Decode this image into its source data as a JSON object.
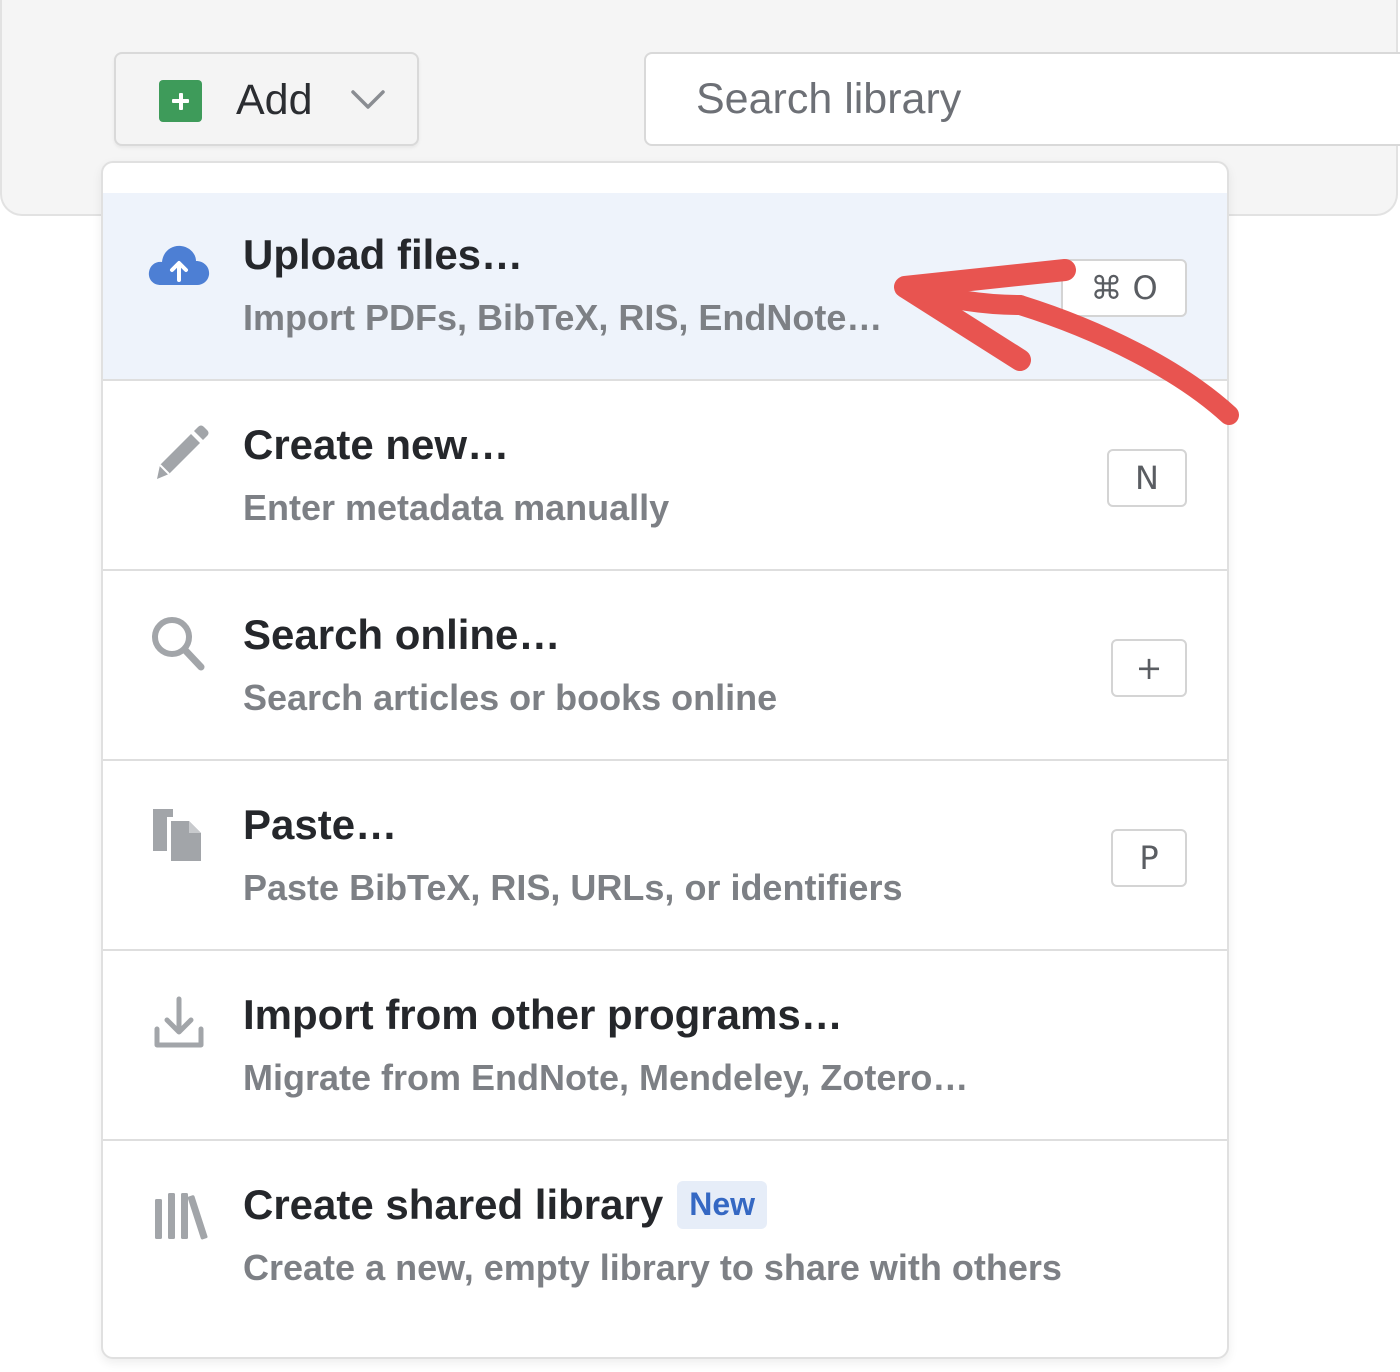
{
  "toolbar": {
    "add_label": "Add",
    "search_placeholder": "Search library"
  },
  "menu": {
    "items": [
      {
        "title": "Upload files…",
        "description": "Import PDFs, BibTeX, RIS, EndNote…",
        "shortcut": "⌘ O",
        "icon": "cloud-upload-icon",
        "highlighted": true
      },
      {
        "title": "Create new…",
        "description": "Enter metadata manually",
        "shortcut": "N",
        "icon": "pencil-icon"
      },
      {
        "title": "Search online…",
        "description": "Search articles or books online",
        "shortcut": "+",
        "icon": "search-icon"
      },
      {
        "title": "Paste…",
        "description": "Paste BibTeX, RIS, URLs, or identifiers",
        "shortcut": "P",
        "icon": "paste-icon"
      },
      {
        "title": "Import from other programs…",
        "description": "Migrate from EndNote, Mendeley, Zotero…",
        "icon": "download-icon"
      },
      {
        "title": "Create shared library",
        "badge": "New",
        "description": "Create a new, empty library to share with others",
        "icon": "library-icon"
      }
    ]
  },
  "colors": {
    "add_icon_green": "#3e9b5a",
    "upload_icon_blue": "#4d7fd4",
    "highlight_bg": "#eef3fb",
    "annotation_arrow_red": "#e85450",
    "badge_text": "#3568c3"
  }
}
